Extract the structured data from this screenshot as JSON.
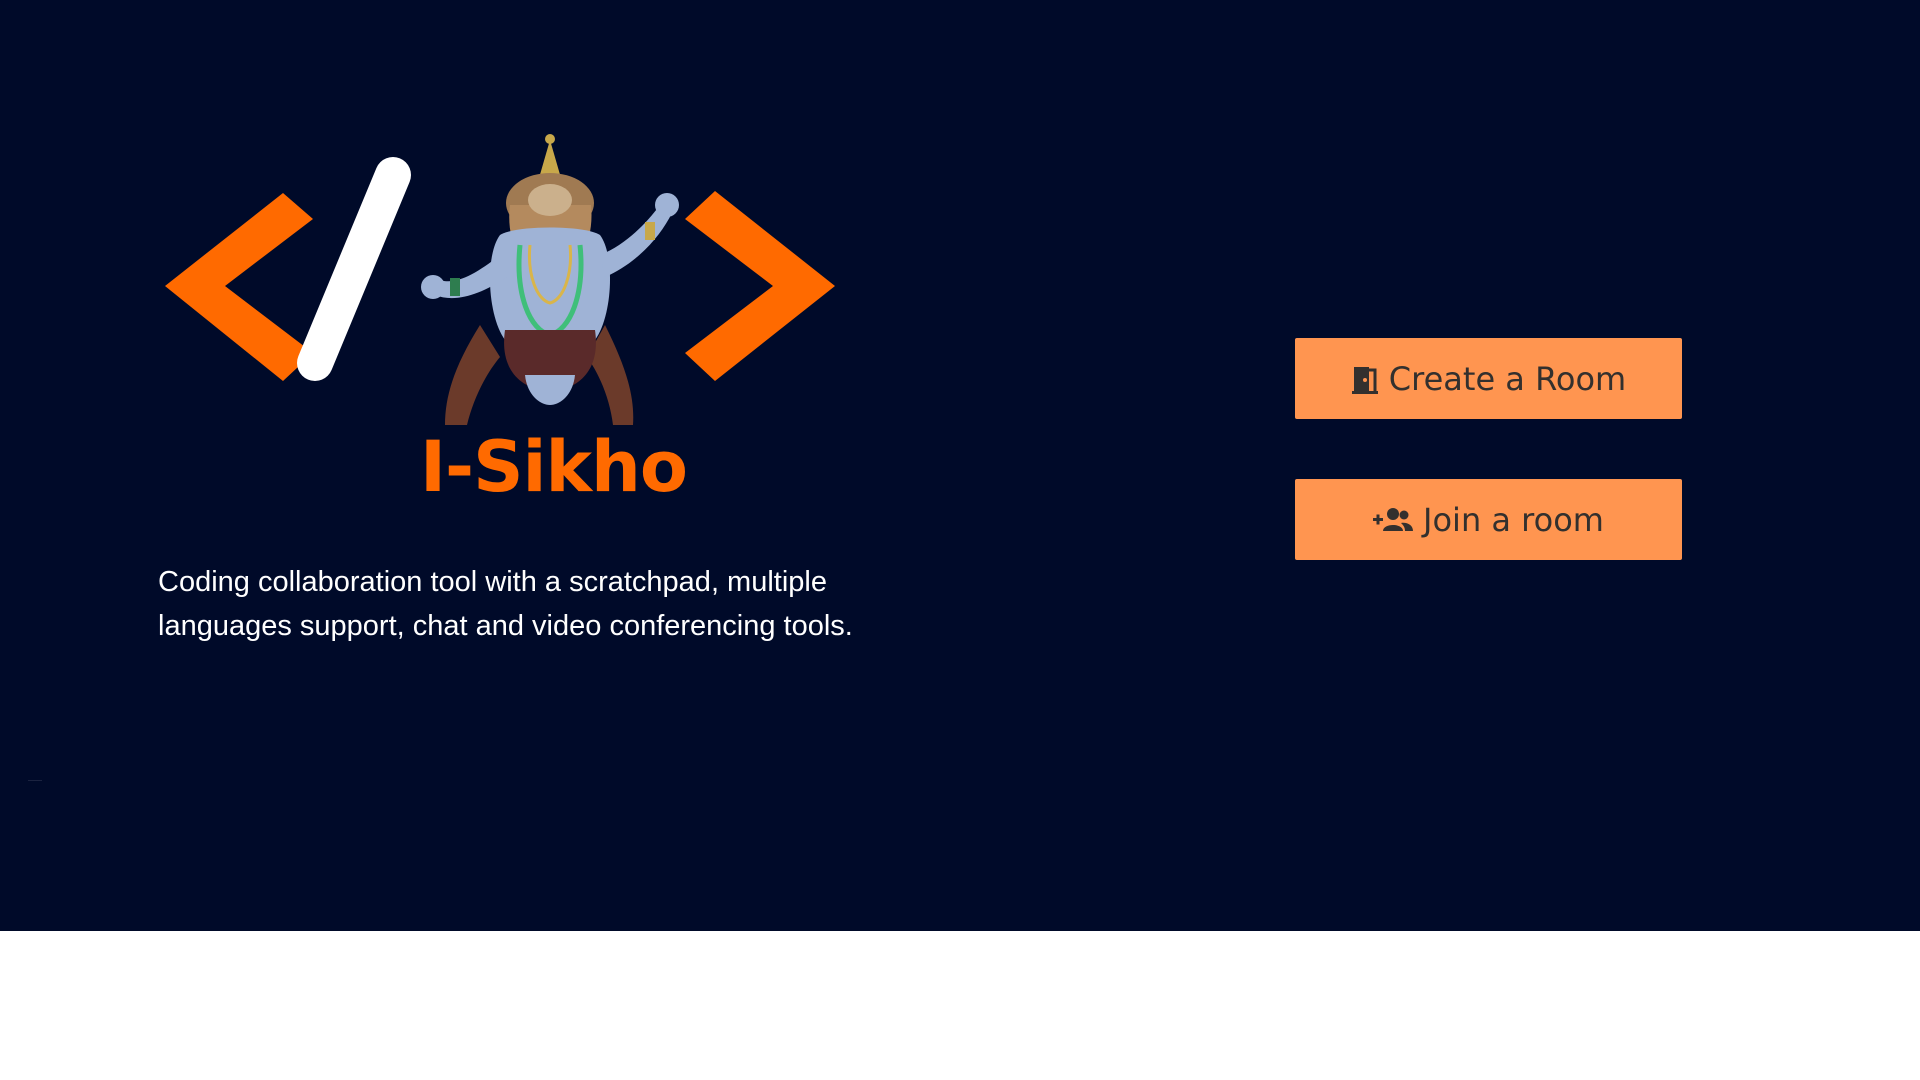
{
  "brand": {
    "name": "I-Sikho",
    "logo_icon": "code-tags-sage-logo",
    "accent_color": "#ff6a00"
  },
  "hero": {
    "background_color": "#000a29",
    "tagline_line1": "Coding collaboration tool with a scratchpad, multiple",
    "tagline_line2": "languages support, chat and video conferencing tools."
  },
  "actions": {
    "create_room": {
      "label": "Create a Room",
      "icon": "door-icon"
    },
    "join_room": {
      "label": "Join a room",
      "icon": "add-user-group-icon"
    },
    "button_color": "#ff9550"
  }
}
